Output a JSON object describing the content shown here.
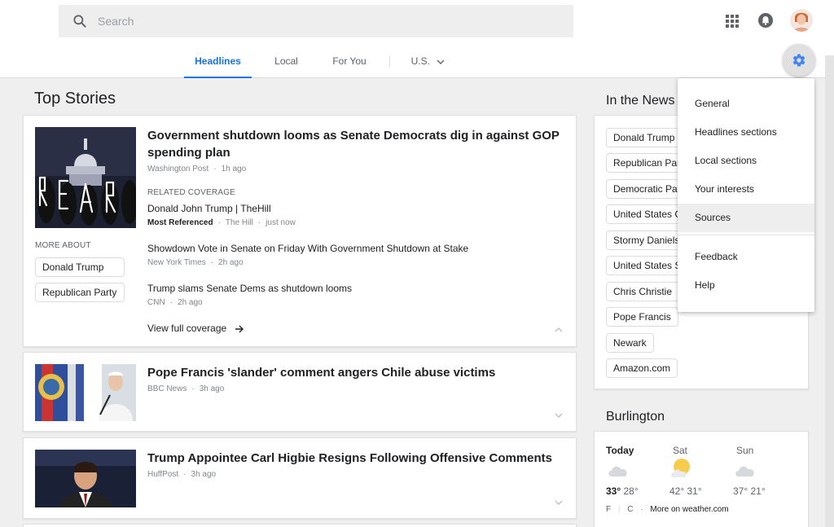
{
  "search": {
    "placeholder": "Search"
  },
  "tabs": [
    {
      "label": "Headlines",
      "active": true
    },
    {
      "label": "Local",
      "active": false
    },
    {
      "label": "For You",
      "active": false
    },
    {
      "label": "U.S.",
      "active": false
    }
  ],
  "main": {
    "title": "Top Stories",
    "stories": [
      {
        "headline": "Government shutdown looms as Senate Democrats dig in against GOP spending plan",
        "source": "Washington Post",
        "time": "1h ago",
        "related_label": "RELATED COVERAGE",
        "related": [
          {
            "headline": "Donald John Trump | TheHill",
            "badge": "Most Referenced",
            "source": "The Hill",
            "time": "just now"
          },
          {
            "headline": "Showdown Vote in Senate on Friday With Government Shutdown at Stake",
            "source": "New York Times",
            "time": "2h ago"
          },
          {
            "headline": "Trump slams Senate Dems as shutdown looms",
            "source": "CNN",
            "time": "2h ago"
          }
        ],
        "more_about_label": "MORE ABOUT",
        "more_about": [
          "Donald Trump",
          "Republican Party"
        ],
        "view_full": "View full coverage"
      },
      {
        "headline": "Pope Francis 'slander' comment angers Chile abuse victims",
        "source": "BBC News",
        "time": "3h ago"
      },
      {
        "headline": "Trump Appointee Carl Higbie Resigns Following Offensive Comments",
        "source": "HuffPost",
        "time": "3h ago"
      }
    ]
  },
  "in_the_news": {
    "title": "In the News",
    "items": [
      "Donald Trump",
      "Republican Party",
      "Democratic Party",
      "United States Congress",
      "Stormy Daniels",
      "United States Senate",
      "Chris Christie",
      "Pope Francis",
      "Newark",
      "Amazon.com"
    ]
  },
  "weather": {
    "location": "Burlington",
    "days": [
      {
        "day": "Today",
        "high": "33°",
        "low": "28°"
      },
      {
        "day": "Sat",
        "high": "42°",
        "low": "31°"
      },
      {
        "day": "Sun",
        "high": "37°",
        "low": "21°"
      }
    ],
    "unit_f": "F",
    "unit_c": "C",
    "more_link": "More on weather.com"
  },
  "settings_menu": {
    "items": [
      "General",
      "Headlines sections",
      "Local sections",
      "Your interests",
      "Sources",
      "Feedback",
      "Help"
    ],
    "hovered": "Sources"
  },
  "colors": {
    "accent": "#1a73e8",
    "gear": "#4285f4"
  }
}
